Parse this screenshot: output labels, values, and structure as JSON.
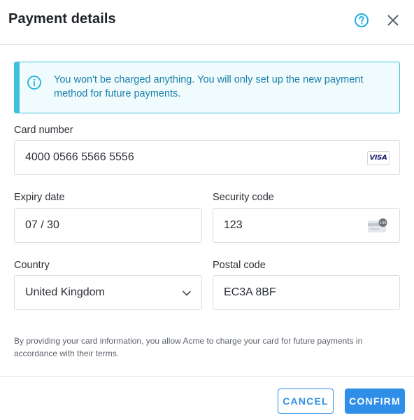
{
  "dialog": {
    "title": "Payment details",
    "help_icon": "question-circle-icon",
    "close_icon": "close-icon"
  },
  "notice": {
    "icon": "info-circle-icon",
    "text": "You won't be charged anything. You will only set up the new payment method for future payments.",
    "accent_color": "#3ec1dc",
    "text_color": "#1a7fa8"
  },
  "form": {
    "card_number": {
      "label": "Card number",
      "value": "4000 0566 5566 5556",
      "brand": "VISA"
    },
    "expiry_date": {
      "label": "Expiry date",
      "value": "07 / 30"
    },
    "security_code": {
      "label": "Security code",
      "value": "123",
      "icon": "card-cvc-icon",
      "icon_text": "135"
    },
    "country": {
      "label": "Country",
      "value": "United Kingdom",
      "icon": "chevron-down-icon"
    },
    "postal_code": {
      "label": "Postal code",
      "value": "EC3A 8BF"
    }
  },
  "legal": {
    "text": "By providing your card information, you allow Acme to charge your card for future payments in accordance with their terms."
  },
  "footer": {
    "cancel_label": "CANCEL",
    "confirm_label": "CONFIRM",
    "button_color": "#2f8fe8"
  }
}
